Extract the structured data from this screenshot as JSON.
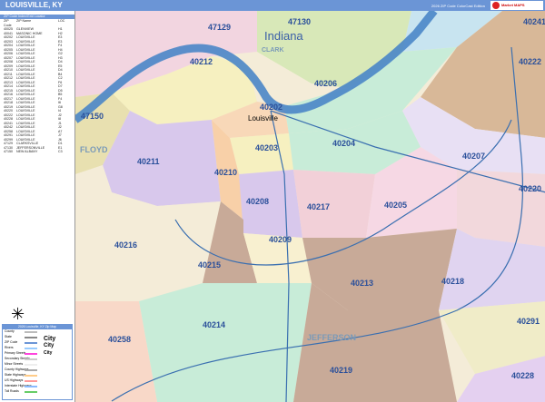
{
  "header": {
    "title": "LOUISVILLE, KY",
    "edition": "2026 ZIP Code ColorCast Edition",
    "logo": "Market MAPS"
  },
  "index": {
    "title": "ZIP Code Index/Grid Locator",
    "columns": [
      "ZIP Code",
      "ZIP Name",
      "LOC"
    ],
    "rows": [
      [
        "40025",
        "GLENVIEW",
        "H1"
      ],
      [
        "40041",
        "MASONIC HOME",
        "H2"
      ],
      [
        "40202",
        "LOUISVILLE",
        "E3"
      ],
      [
        "40203",
        "LOUISVILLE",
        "E3"
      ],
      [
        "40204",
        "LOUISVILLE",
        "F4"
      ],
      [
        "40205",
        "LOUISVILLE",
        "H4"
      ],
      [
        "40206",
        "LOUISVILLE",
        "G2"
      ],
      [
        "40207",
        "LOUISVILLE",
        "H3"
      ],
      [
        "40208",
        "LOUISVILLE",
        "D4"
      ],
      [
        "40209",
        "LOUISVILLE",
        "E5"
      ],
      [
        "40210",
        "LOUISVILLE",
        "D4"
      ],
      [
        "40211",
        "LOUISVILLE",
        "B4"
      ],
      [
        "40212",
        "LOUISVILLE",
        "C2"
      ],
      [
        "40213",
        "LOUISVILLE",
        "F6"
      ],
      [
        "40214",
        "LOUISVILLE",
        "D7"
      ],
      [
        "40215",
        "LOUISVILLE",
        "D5"
      ],
      [
        "40216",
        "LOUISVILLE",
        "B5"
      ],
      [
        "40217",
        "LOUISVILLE",
        "F4"
      ],
      [
        "40218",
        "LOUISVILLE",
        "I6"
      ],
      [
        "40219",
        "LOUISVILLE",
        "G8"
      ],
      [
        "40220",
        "LOUISVILLE",
        "I4"
      ],
      [
        "40222",
        "LOUISVILLE",
        "J2"
      ],
      [
        "40228",
        "LOUISVILLE",
        "I8"
      ],
      [
        "40241",
        "LOUISVILLE",
        "J1"
      ],
      [
        "40242",
        "LOUISVILLE",
        "J2"
      ],
      [
        "40258",
        "LOUISVILLE",
        "A7"
      ],
      [
        "40291",
        "LOUISVILLE",
        "J7"
      ],
      [
        "40299",
        "LOUISVILLE",
        "J6"
      ],
      [
        "47129",
        "CLARKSVILLE",
        "D1"
      ],
      [
        "47130",
        "JEFFERSONVILLE",
        "E1"
      ],
      [
        "47150",
        "NEW ALBANY",
        "C3"
      ]
    ]
  },
  "legend": {
    "title": "2026 Louisville, KY Zip Map",
    "items": [
      "County",
      "State",
      "ZIP Code",
      "Rivers",
      "Primary Streets",
      "Secondary Streets",
      "Minor Streets",
      "County Highways",
      "State Highways",
      "US Highways",
      "Interstate Highways",
      "Toll Roads"
    ],
    "city_label": "City"
  },
  "map": {
    "state": "Indiana",
    "city": "Louisville",
    "counties": [
      "FLOYD",
      "CLARK",
      "JEFFERSON"
    ],
    "zips": [
      "47130",
      "47129",
      "40212",
      "40206",
      "40222",
      "40241",
      "47150",
      "40202",
      "40211",
      "40203",
      "40204",
      "40207",
      "40210",
      "40220",
      "40208",
      "40217",
      "40205",
      "40216",
      "40209",
      "40215",
      "40213",
      "40218",
      "40214",
      "40291",
      "40258",
      "40219",
      "40228"
    ],
    "colors": {
      "river": "#4a86c8",
      "zip_label": "#2a4f9a",
      "header": "#6b95d6"
    }
  }
}
